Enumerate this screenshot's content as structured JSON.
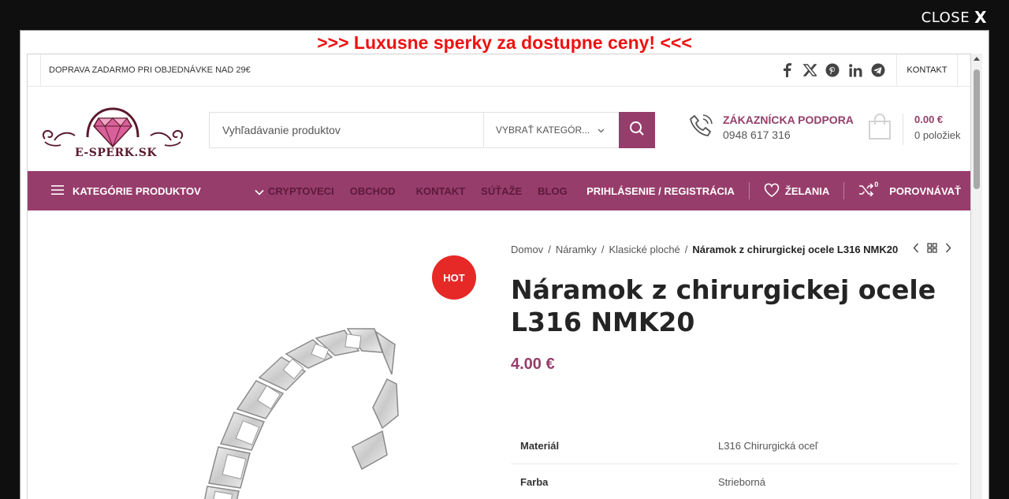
{
  "overlay": {
    "close_label": "CLOSE",
    "close_x": "X",
    "promo": ">>> Luxusne sperky za dostupne ceny! <<<"
  },
  "topbar": {
    "shipping": "DOPRAVA ZADARMO PRI OBJEDNÁVKE NAD 29€",
    "social_icons": [
      "facebook-icon",
      "x-icon",
      "pinterest-icon",
      "linkedin-icon",
      "telegram-icon"
    ],
    "kontakt": "KONTAKT"
  },
  "header": {
    "logo_text": "E-SPERK.SK",
    "search": {
      "placeholder": "Vyhľadávanie produktov",
      "category": "VYBRAŤ KATEGÓR..."
    },
    "support": {
      "title": "ZÁKAZNÍCKA PODPORA",
      "phone": "0948 617 316"
    },
    "cart": {
      "total": "0.00 €",
      "count": "0 položiek"
    }
  },
  "nav": {
    "categories": "KATEGÓRIE PRODUKTOV",
    "links": [
      "CRYPTOVECI",
      "OBCHOD",
      "KONTAKT",
      "SÚŤAŽE",
      "BLOG"
    ],
    "login": "PRIHLÁSENIE / REGISTRÁCIA",
    "wishlist": "ŽELANIA",
    "compare": "POROVNÁVAŤ",
    "compare_count": "0"
  },
  "product": {
    "badge": "HOT",
    "breadcrumb": [
      "Domov",
      "Náramky",
      "Klasické ploché"
    ],
    "breadcrumb_current": "Náramok z chirurgickej ocele L316 NMK20",
    "title": "Náramok z chirurgickej ocele L316 NMK20",
    "price": "4.00 €",
    "attributes": [
      {
        "key": "Materiál",
        "value": "L316 Chirurgická oceľ"
      },
      {
        "key": "Farba",
        "value": "Strieborná"
      }
    ]
  },
  "colors": {
    "brand": "#973d6b",
    "brand_dark_text": "#5c1a3c",
    "promo_red": "#ee1111",
    "hot_badge": "#e62926"
  }
}
